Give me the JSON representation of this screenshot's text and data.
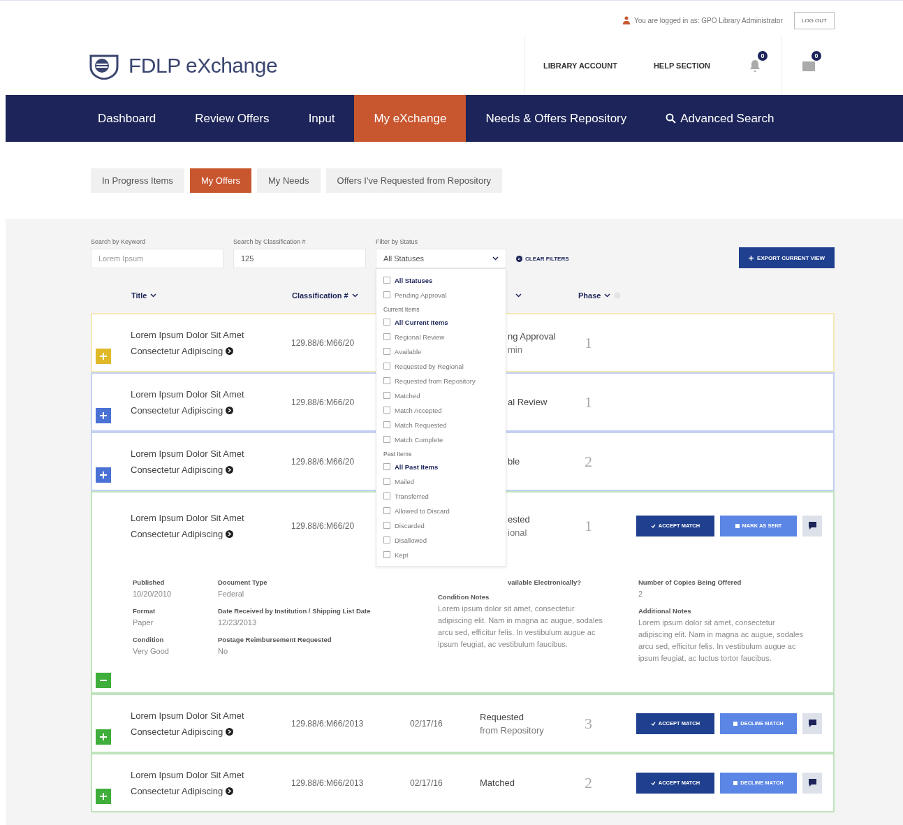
{
  "top_bar": {
    "login_text": "You are logged in as: GPO Library Administrator",
    "logout": "LOG OUT"
  },
  "header": {
    "brand": "FDLP eXchange",
    "links": [
      "LIBRARY ACCOUNT",
      "HELP SECTION"
    ],
    "notifications": [
      {
        "kind": "bell",
        "count": "0"
      },
      {
        "kind": "inbox",
        "count": "0"
      }
    ]
  },
  "nav": [
    {
      "label": "Dashboard",
      "selected": false
    },
    {
      "label": "Review Offers",
      "selected": false
    },
    {
      "label": "Input",
      "selected": false
    },
    {
      "label": "My eXchange",
      "selected": true
    },
    {
      "label": "Needs & Offers Repository",
      "selected": false
    },
    {
      "label": "Advanced Search",
      "selected": false,
      "kind": "search"
    }
  ],
  "subtabs": [
    {
      "label": "In Progress Items",
      "selected": false
    },
    {
      "label": "My Offers",
      "selected": true
    },
    {
      "label": "My Needs",
      "selected": false
    },
    {
      "label": "Offers I've Requested from Repository",
      "selected": false
    }
  ],
  "filters": {
    "keyword": {
      "label": "Search by Keyword",
      "placeholder": "Lorem Ipsum"
    },
    "classification": {
      "label": "Search by Classification #",
      "value": "125"
    },
    "status": {
      "label": "Filter by Status",
      "value": "All Statuses",
      "expanded": true
    },
    "clear": "CLEAR FILTERS",
    "export": "EXPORT CURRENT VIEW"
  },
  "status_options": [
    {
      "kind": "option",
      "label": "All Statuses",
      "bold": true,
      "checked": false
    },
    {
      "kind": "option",
      "label": "Pending Approval",
      "bold": false,
      "checked": false
    },
    {
      "kind": "heading",
      "label": "Current Items"
    },
    {
      "kind": "option",
      "label": "All Current Items",
      "bold": true,
      "checked": false
    },
    {
      "kind": "option",
      "label": "Regional Review",
      "bold": false,
      "checked": false
    },
    {
      "kind": "option",
      "label": "Available",
      "bold": false,
      "checked": false
    },
    {
      "kind": "option",
      "label": "Requested by Regional",
      "bold": false,
      "checked": false
    },
    {
      "kind": "option",
      "label": "Requested from Repository",
      "bold": false,
      "checked": false
    },
    {
      "kind": "option",
      "label": "Matched",
      "bold": false,
      "checked": false
    },
    {
      "kind": "option",
      "label": "Match Accepted",
      "bold": false,
      "checked": false
    },
    {
      "kind": "option",
      "label": "Match Requested",
      "bold": false,
      "checked": false
    },
    {
      "kind": "option",
      "label": "Match Complete",
      "bold": false,
      "checked": false
    },
    {
      "kind": "heading",
      "label": "Past Items"
    },
    {
      "kind": "option",
      "label": "All Past Items",
      "bold": true,
      "checked": false
    },
    {
      "kind": "option",
      "label": "Mailed",
      "bold": false,
      "checked": false
    },
    {
      "kind": "option",
      "label": "Transferred",
      "bold": false,
      "checked": false
    },
    {
      "kind": "option",
      "label": "Allowed to Discard",
      "bold": false,
      "checked": false
    },
    {
      "kind": "option",
      "label": "Discarded",
      "bold": false,
      "checked": false
    },
    {
      "kind": "option",
      "label": "Disallowed",
      "bold": false,
      "checked": false
    },
    {
      "kind": "option",
      "label": "Kept",
      "bold": false,
      "checked": false
    }
  ],
  "table": {
    "columns": [
      {
        "label": "Title",
        "info": false
      },
      {
        "label": "Classification #",
        "info": false
      },
      {
        "info": false
      },
      {
        "label": "Phase",
        "info": true
      }
    ],
    "rows": [
      {
        "color": "#e0b928",
        "expanded": false,
        "covered": true,
        "title": [
          "Lorem Ipsum Dolor Sit Amet",
          "Consectetur Adipiscing"
        ],
        "classification": "129.88/6:M66/20",
        "status": [
          "ng Approval",
          "min"
        ],
        "phase": "1",
        "actions": []
      },
      {
        "color": "#4a72d4",
        "expanded": false,
        "covered": true,
        "title": [
          "Lorem Ipsum Dolor Sit Amet",
          "Consectetur Adipiscing"
        ],
        "classification": "129.88/6:M66/20",
        "status": [
          "al Review"
        ],
        "phase": "1",
        "actions": []
      },
      {
        "color": "#4a72d4",
        "expanded": false,
        "covered": true,
        "title": [
          "Lorem Ipsum Dolor Sit Amet",
          "Consectetur Adipiscing"
        ],
        "classification": "129.88/6:M66/20",
        "status": [
          "ble"
        ],
        "phase": "2",
        "actions": []
      },
      {
        "color": "#3fae3a",
        "expanded": true,
        "covered": true,
        "title": [
          "Lorem Ipsum Dolor Sit Amet",
          "Consectetur Adipiscing"
        ],
        "classification": "129.88/6:M66/20",
        "status": [
          "ested",
          "ional"
        ],
        "phase": "1",
        "actions": [
          {
            "kind": "accept",
            "label": "ACCEPT MATCH"
          },
          {
            "kind": "secondary",
            "label": "MARK AS SENT"
          }
        ],
        "details": [
          [
            {
              "label": "Published",
              "value": "10/20/2010"
            },
            {
              "label": "Format",
              "value": "Paper"
            },
            {
              "label": "Condition",
              "value": "Very Good"
            }
          ],
          [
            {
              "label": "Document Type",
              "value": "Federal"
            },
            {
              "label": "Date Received by Institution / Shipping List Date",
              "value": "12/23/2013"
            },
            {
              "label": "Postage Reimbursement Requested",
              "value": "No"
            }
          ],
          [
            {
              "label": "vailable Electronically?",
              "covered": true
            },
            {
              "label": "Condition Notes",
              "value": "Lorem ipsum dolor sit amet, consectetur adipiscing elit. Nam in magna ac augue, sodales arcu sed, efficitur felis. In vestibulum augue ac ipsum feugiat, ac vestibulum faucibus."
            }
          ],
          [
            {
              "label": "Number of Copies Being Offered",
              "value": "2"
            },
            {
              "label": "Additional Notes",
              "value": "Lorem ipsum dolor sit amet, consectetur adipiscing elit. Nam in magna ac augue, sodales arcu sed, efficitur felis. In vestibulum augue ac ipsum feugiat, ac luctus tortor faucibus."
            }
          ]
        ]
      },
      {
        "color": "#3fae3a",
        "expanded": false,
        "covered": false,
        "title": [
          "Lorem Ipsum Dolor Sit Amet",
          "Consectetur Adipiscing"
        ],
        "classification": "129.88/6:M66/2013",
        "date": "02/17/16",
        "status": [
          "Requested",
          "from Repository"
        ],
        "phase": "3",
        "actions": [
          {
            "kind": "accept",
            "label": "ACCEPT MATCH"
          },
          {
            "kind": "secondary",
            "label": "DECLINE MATCH"
          }
        ]
      },
      {
        "color": "#3fae3a",
        "expanded": false,
        "covered": false,
        "title": [
          "Lorem Ipsum Dolor Sit Amet",
          "Consectetur Adipiscing"
        ],
        "classification": "129.88/6:M66/2013",
        "date": "02/17/16",
        "status": [
          "Matched"
        ],
        "phase": "2",
        "actions": [
          {
            "kind": "accept",
            "label": "ACCEPT MATCH"
          },
          {
            "kind": "secondary",
            "label": "DECLINE MATCH"
          }
        ]
      }
    ]
  }
}
